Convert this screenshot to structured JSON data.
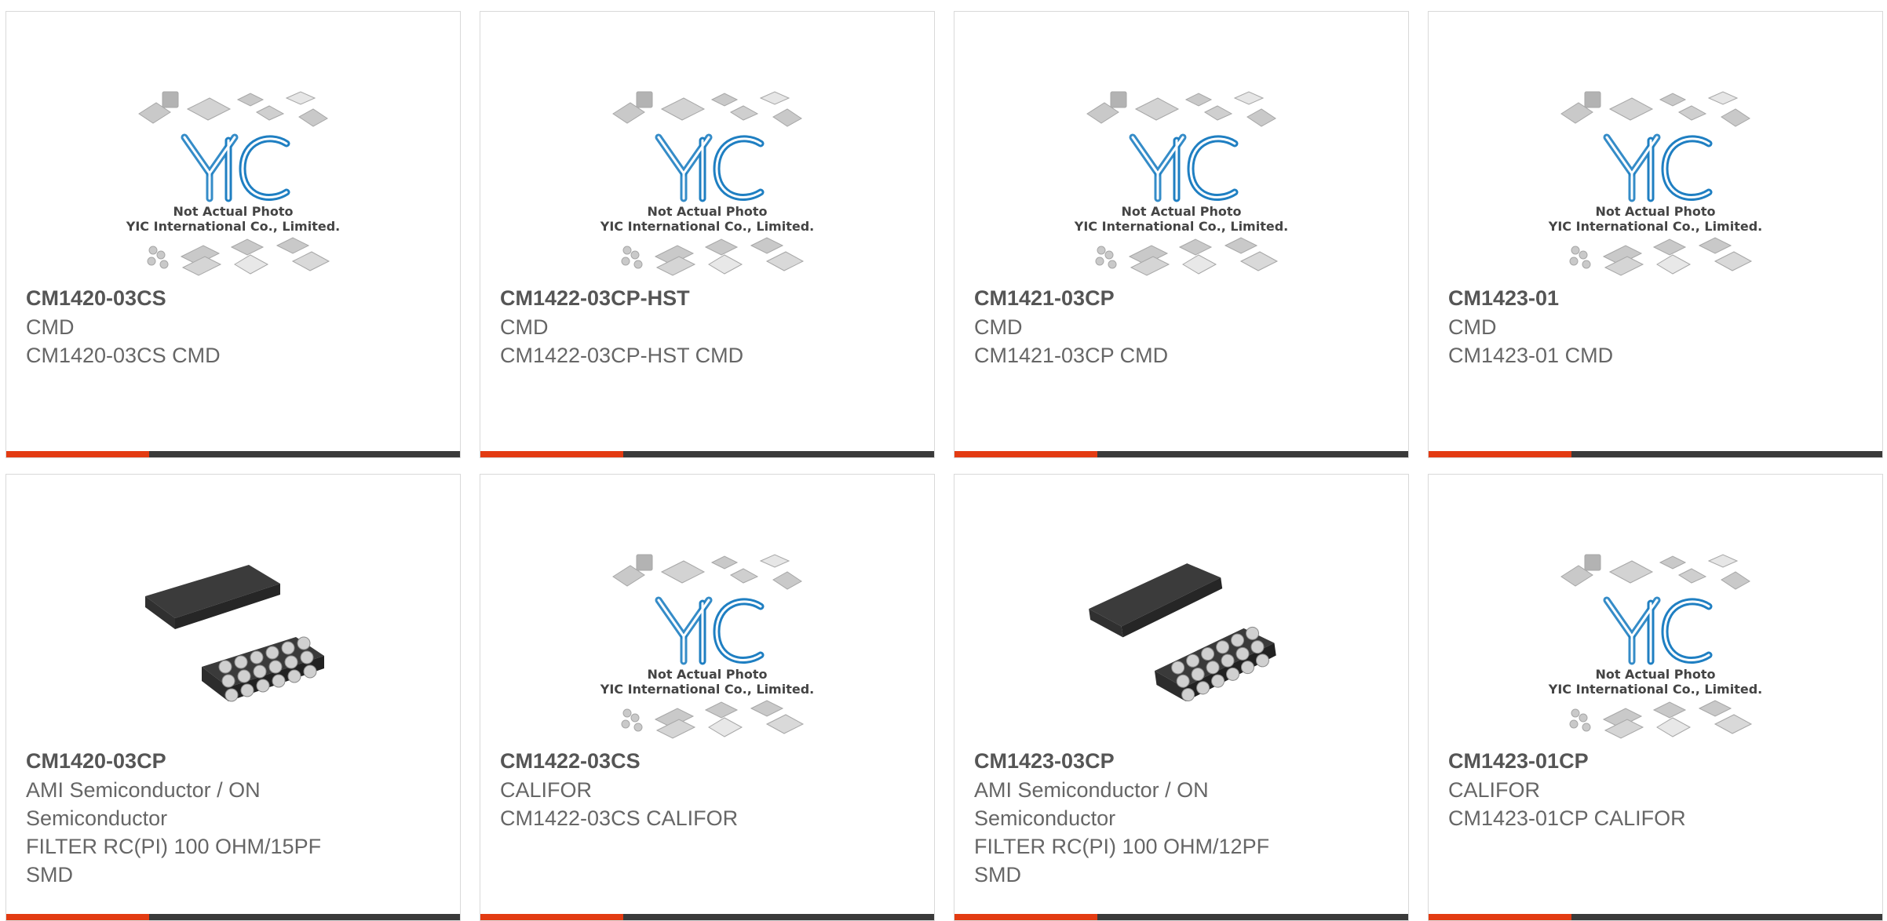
{
  "placeholder": {
    "line1": "Not Actual Photo",
    "line2": "YIC International Co., Limited.",
    "logo": "YIC"
  },
  "products": [
    {
      "name": "CM1420-03CS",
      "lines": [
        "CMD",
        "CM1420-03CS CMD"
      ],
      "image": "placeholder-logo"
    },
    {
      "name": "CM1422-03CP-HST",
      "lines": [
        "CMD",
        "CM1422-03CP-HST CMD"
      ],
      "image": "placeholder-logo"
    },
    {
      "name": "CM1421-03CP",
      "lines": [
        "CMD",
        "CM1421-03CP CMD"
      ],
      "image": "placeholder-logo"
    },
    {
      "name": "CM1423-01",
      "lines": [
        "CMD",
        "CM1423-01 CMD"
      ],
      "image": "placeholder-logo"
    },
    {
      "name": "CM1420-03CP",
      "lines": [
        "AMI Semiconductor / ON",
        "Semiconductor",
        "FILTER RC(PI) 100 OHM/15PF",
        "SMD"
      ],
      "image": "chip-photo"
    },
    {
      "name": "CM1422-03CS",
      "lines": [
        "CALIFOR",
        "CM1422-03CS CALIFOR"
      ],
      "image": "placeholder-logo"
    },
    {
      "name": "CM1423-03CP",
      "lines": [
        "AMI Semiconductor / ON",
        "Semiconductor",
        "FILTER RC(PI) 100 OHM/12PF",
        "SMD"
      ],
      "image": "chip-photo"
    },
    {
      "name": "CM1423-01CP",
      "lines": [
        "CALIFOR",
        "CM1423-01CP CALIFOR"
      ],
      "image": "placeholder-logo"
    }
  ],
  "colors": {
    "accent": "#e33b12",
    "bar": "#3a3a3a",
    "logo": "#1f7fc2"
  }
}
